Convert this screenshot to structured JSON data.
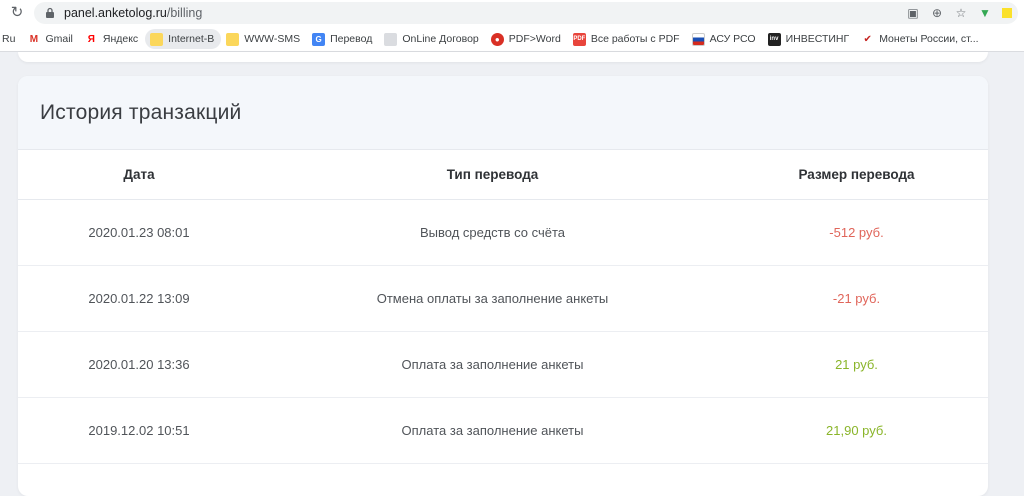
{
  "browser": {
    "url_domain": "panel.anketolog.ru",
    "url_path": "/billing",
    "bookmarks": [
      {
        "label": "Ru",
        "icon": ""
      },
      {
        "label": "Gmail",
        "icon": "gmail-icon"
      },
      {
        "label": "Яндекс",
        "icon": "yandex-icon"
      },
      {
        "label": "Internet-B",
        "icon": "folder-icon"
      },
      {
        "label": "WWW-SMS",
        "icon": "folder-icon"
      },
      {
        "label": "Перевод",
        "icon": "translate-icon"
      },
      {
        "label": "OnLine Договор",
        "icon": "document-icon"
      },
      {
        "label": "PDF>Word",
        "icon": "pdf-word-icon"
      },
      {
        "label": "Все работы с PDF",
        "icon": "pdf-icon"
      },
      {
        "label": "АСУ РСО",
        "icon": "russian-flag-icon"
      },
      {
        "label": "ИНВЕСТИНГ",
        "icon": "investing-icon"
      },
      {
        "label": "Монеты России, ст...",
        "icon": "checkmark-icon"
      }
    ]
  },
  "card": {
    "title": "История транзакций"
  },
  "table": {
    "headers": [
      "Дата",
      "Тип перевода",
      "Размер перевода"
    ],
    "rows": [
      {
        "date": "2020.01.23 08:01",
        "type": "Вывод средств со счёта",
        "amount": "-512 руб.",
        "sign": "neg"
      },
      {
        "date": "2020.01.22 13:09",
        "type": "Отмена оплаты за заполнение анкеты",
        "amount": "-21 руб.",
        "sign": "neg"
      },
      {
        "date": "2020.01.20 13:36",
        "type": "Оплата за заполнение анкеты",
        "amount": "21 руб.",
        "sign": "pos"
      },
      {
        "date": "2019.12.02 10:51",
        "type": "Оплата за заполнение анкеты",
        "amount": "21,90 руб.",
        "sign": "pos"
      }
    ]
  },
  "colors": {
    "negative": "#e0655a",
    "positive": "#8ab52a"
  }
}
